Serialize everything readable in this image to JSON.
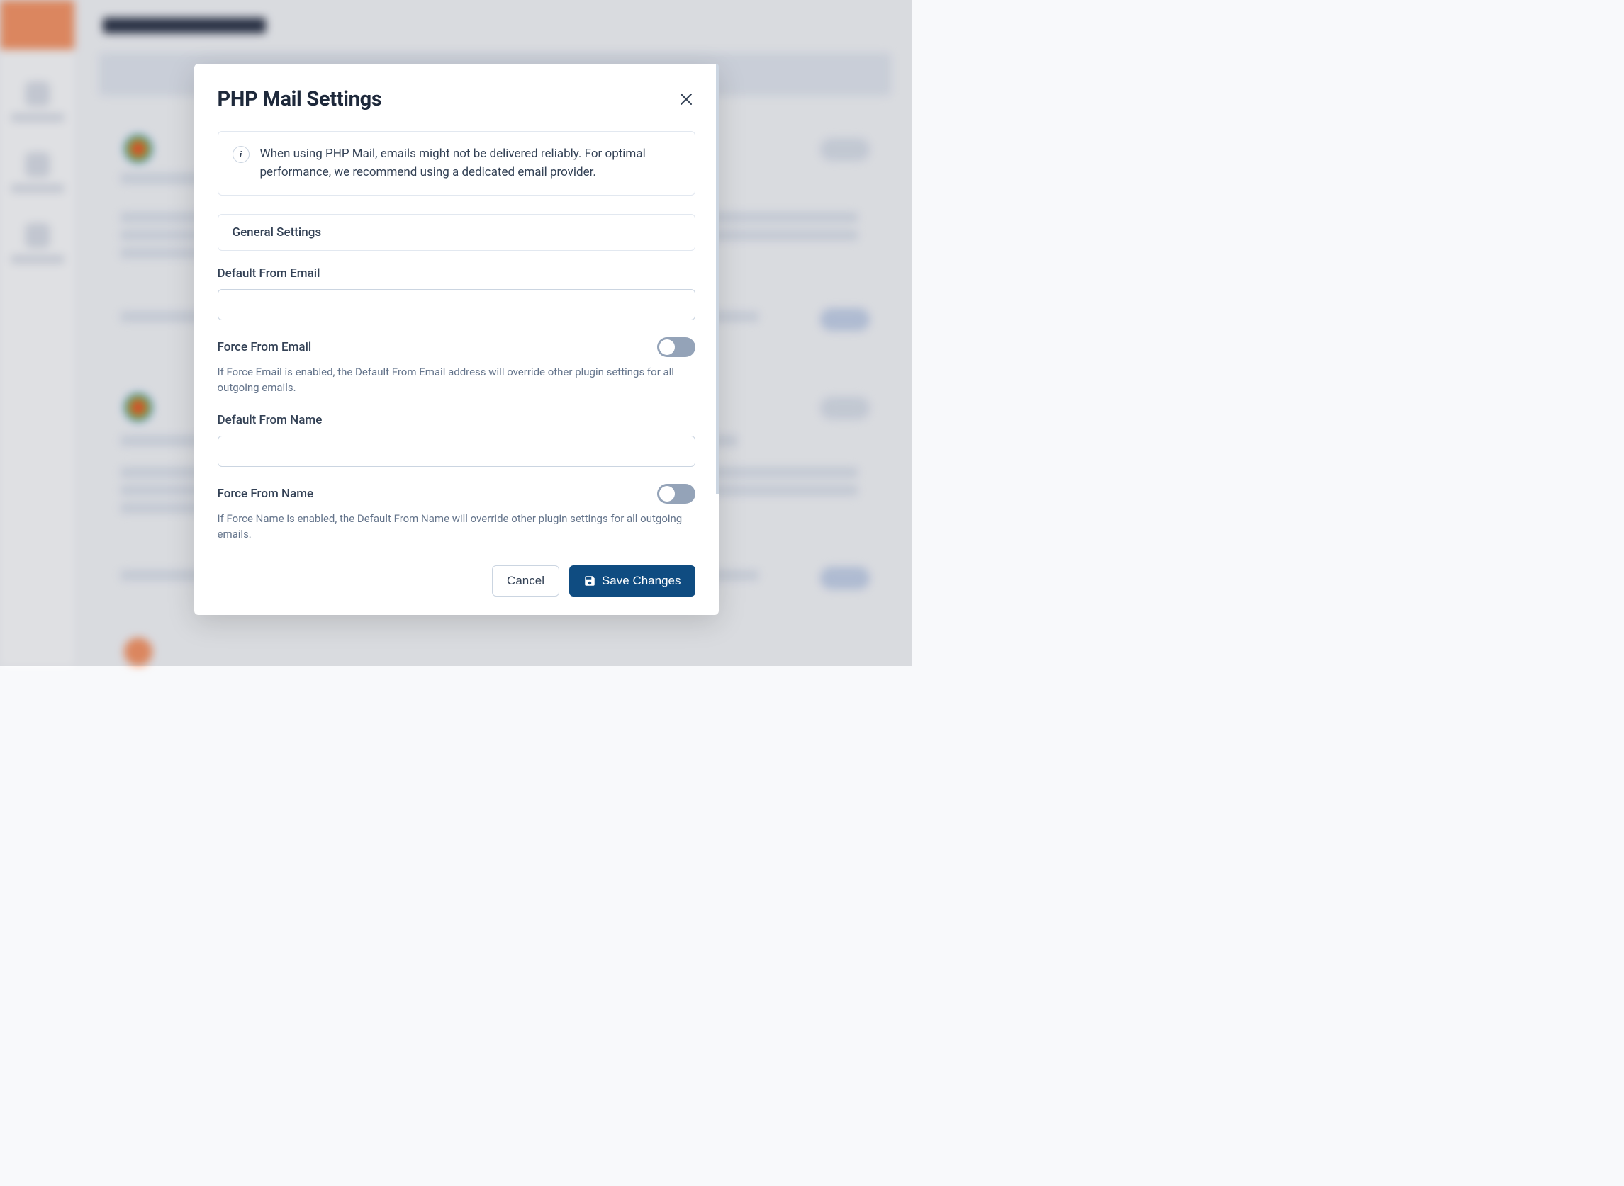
{
  "modal": {
    "title": "PHP Mail Settings",
    "info_banner": "When using PHP Mail, emails might not be delivered reliably. For optimal performance, we recommend using a dedicated email provider.",
    "section_header": "General Settings",
    "fields": {
      "default_from_email": {
        "label": "Default From Email",
        "value": ""
      },
      "force_from_email": {
        "label": "Force From Email",
        "hint": "If Force Email is enabled, the Default From Email address will override other plugin settings for all outgoing emails.",
        "enabled": false
      },
      "default_from_name": {
        "label": "Default From Name",
        "value": ""
      },
      "force_from_name": {
        "label": "Force From Name",
        "hint": "If Force Name is enabled, the Default From Name will override other plugin settings for all outgoing emails.",
        "enabled": false
      }
    },
    "buttons": {
      "cancel": "Cancel",
      "save": "Save Changes"
    }
  }
}
